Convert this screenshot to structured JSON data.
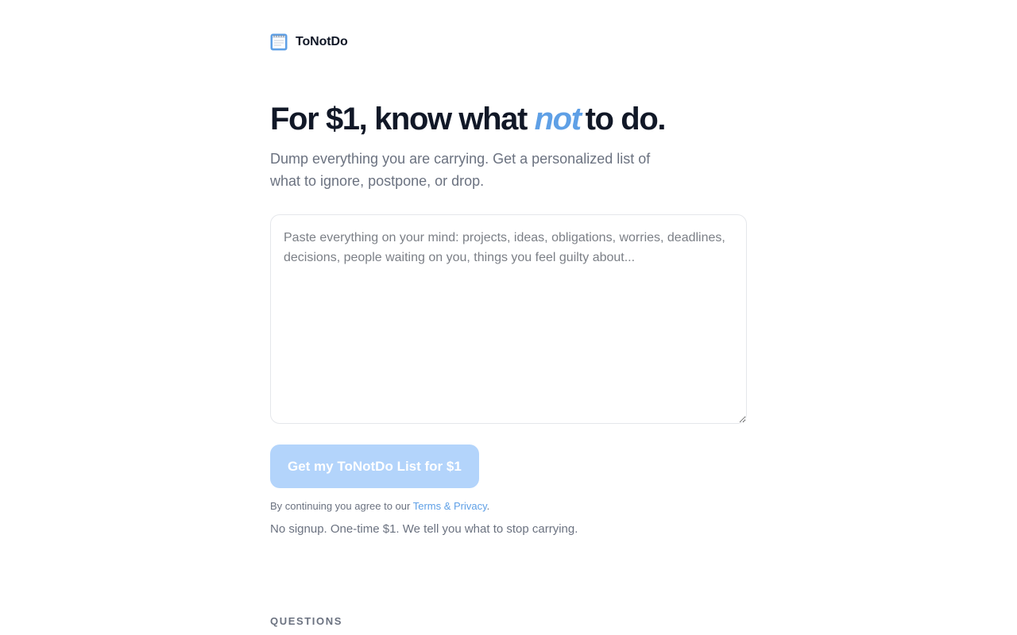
{
  "brand": {
    "name": "ToNotDo",
    "icon": "notepad-icon",
    "icon_color": "#5fa0e6"
  },
  "hero": {
    "title_before": "For $1, know what ",
    "title_accent": "not",
    "title_after": "to do.",
    "subtitle": "Dump everything you are carrying. Get a personalized list of what to ignore, postpone, or drop."
  },
  "input": {
    "value": "",
    "placeholder": "Paste everything on your mind: projects, ideas, obligations, worries, deadlines, decisions, people waiting on you, things you feel guilty about..."
  },
  "cta": {
    "label": "Get my ToNotDo List for $1",
    "color": "#b3d4fb"
  },
  "legal": {
    "prefix": "By continuing you agree to our ",
    "link_text": "Terms & Privacy",
    "suffix": "."
  },
  "note": "No signup. One-time $1. We tell you what to stop carrying.",
  "sections": {
    "questions_label": "QUESTIONS"
  },
  "colors": {
    "accent": "#5fa0e6",
    "text": "#111827",
    "muted": "#6b7280"
  }
}
